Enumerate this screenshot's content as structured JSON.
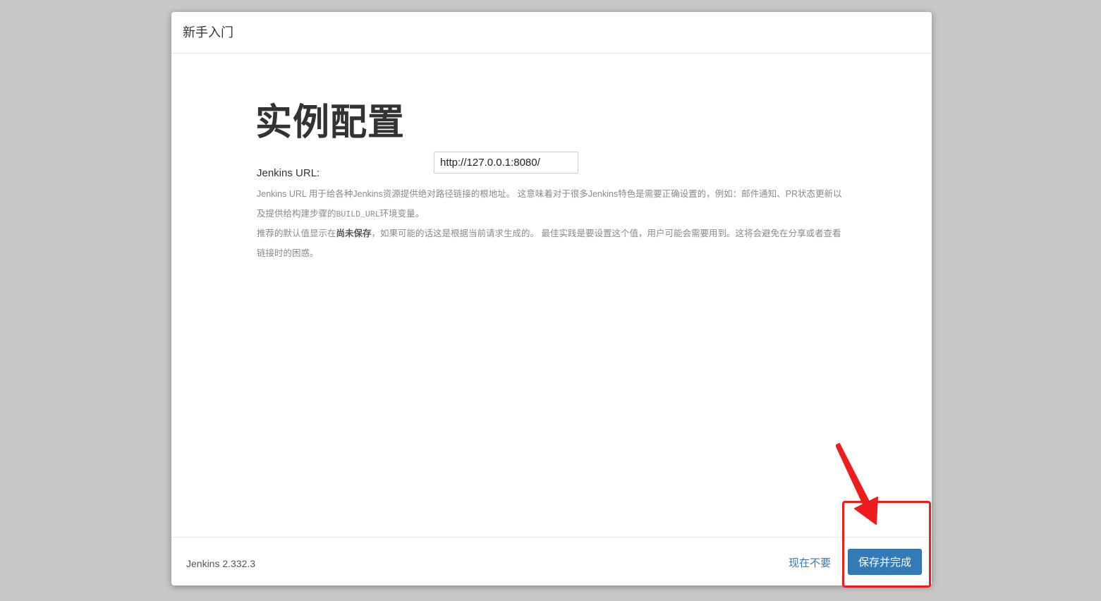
{
  "dialog": {
    "title": "新手入门"
  },
  "main": {
    "heading": "实例配置",
    "url_label": "Jenkins URL:",
    "url_value": "http://127.0.0.1:8080/",
    "help": {
      "line1_prefix": "Jenkins URL 用于给各种Jenkins资源提供绝对路径链接的根地址。 这意味着对于很多Jenkins特色是需要正确设置的，例如：邮件通知、PR状态更新以及提供给构建步骤的",
      "line1_code": "BUILD_URL",
      "line1_suffix": "环境变量。",
      "line2_prefix": "推荐的默认值显示在",
      "line2_bold": "尚未保存",
      "line2_suffix": "，如果可能的话这是根据当前请求生成的。 最佳实践是要设置这个值，用户可能会需要用到。这将会避免在分享或者查看链接时的困惑。"
    }
  },
  "footer": {
    "version": "Jenkins 2.332.3",
    "skip_label": "现在不要",
    "save_label": "保存并完成"
  },
  "colors": {
    "primary": "#337ab7",
    "annotation": "#ee1c1c",
    "backdrop": "#c8c8c8"
  }
}
